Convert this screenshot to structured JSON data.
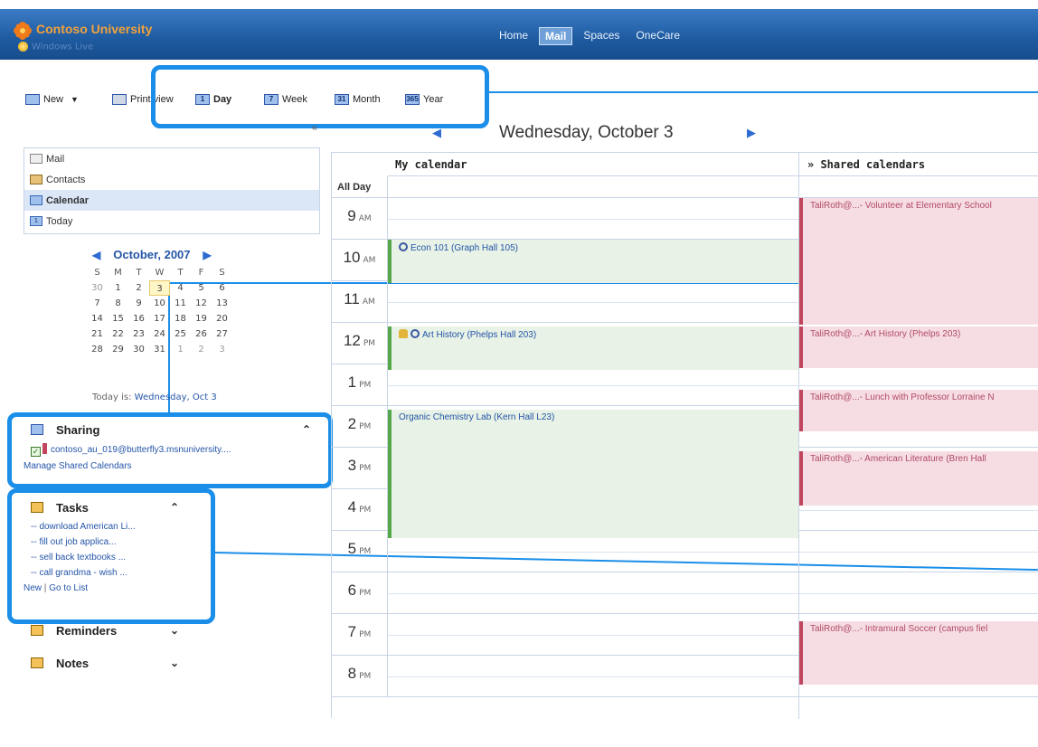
{
  "app": {
    "brand": "Contoso University",
    "brand_sub": "Windows Live"
  },
  "topnav": [
    "Home",
    "Mail",
    "Spaces",
    "OneCare"
  ],
  "toolbar": {
    "new": "New",
    "print": "Print view",
    "day": "Day",
    "week": "Week",
    "month": "Month",
    "year": "Year"
  },
  "nav": {
    "mail": "Mail",
    "contacts": "Contacts",
    "calendar": "Calendar",
    "today": "Today"
  },
  "mini_calendar": {
    "month": "October, 2007",
    "dow": [
      "S",
      "M",
      "T",
      "W",
      "T",
      "F",
      "S"
    ],
    "weeks": [
      [
        "30",
        "1",
        "2",
        "3",
        "4",
        "5",
        "6"
      ],
      [
        "7",
        "8",
        "9",
        "10",
        "11",
        "12",
        "13"
      ],
      [
        "14",
        "15",
        "16",
        "17",
        "18",
        "19",
        "20"
      ],
      [
        "21",
        "22",
        "23",
        "24",
        "25",
        "26",
        "27"
      ],
      [
        "28",
        "29",
        "30",
        "31",
        "1",
        "2",
        "3"
      ]
    ],
    "today_label": "Today is:",
    "today_value": "Wednesday, Oct 3"
  },
  "sharing": {
    "title": "Sharing",
    "calendar": "contoso_au_019@butterfly3.msnuniversity....",
    "manage": "Manage Shared Calendars"
  },
  "tasks": {
    "title": "Tasks",
    "items": [
      "-- download American Li...",
      "-- fill out job applica...",
      "-- sell back textbooks ...",
      "-- call grandma - wish ..."
    ],
    "new": "New",
    "sep": "|",
    "go": "Go to List"
  },
  "reminders": {
    "title": "Reminders"
  },
  "notes": {
    "title": "Notes"
  },
  "calendar": {
    "date_title": "Wednesday, October 3",
    "my_calendar": "My calendar",
    "shared_calendars": "» Shared calendars",
    "all_day": "All Day",
    "hours": [
      {
        "n": "9",
        "ap": "AM"
      },
      {
        "n": "10",
        "ap": "AM"
      },
      {
        "n": "11",
        "ap": "AM"
      },
      {
        "n": "12",
        "ap": "PM"
      },
      {
        "n": "1",
        "ap": "PM"
      },
      {
        "n": "2",
        "ap": "PM"
      },
      {
        "n": "3",
        "ap": "PM"
      },
      {
        "n": "4",
        "ap": "PM"
      },
      {
        "n": "5",
        "ap": "PM"
      },
      {
        "n": "6",
        "ap": "PM"
      },
      {
        "n": "7",
        "ap": "PM"
      },
      {
        "n": "8",
        "ap": "PM"
      }
    ],
    "my_events": {
      "econ": "Econ 101 (Graph Hall 105)",
      "art": "Art History (Phelps Hall 203)",
      "chem": "Organic Chemistry Lab (Kern Hall L23)"
    },
    "shared_events": {
      "volunteer": "TaliRoth@...- Volunteer at Elementary School",
      "art": "TaliRoth@...- Art History  (Phelps 203)",
      "lunch": "TaliRoth@...- Lunch with Professor Lorraine N",
      "lit": "TaliRoth@...- American Literature  (Bren Hall",
      "soccer": "TaliRoth@...- Intramural Soccer  (campus fiel"
    }
  },
  "colors": {
    "brand_bar": "#1e5aa0",
    "callout": "#1a8ee8",
    "my_event_bg": "#e8f2e6",
    "shared_event_bg": "#f6dde3"
  }
}
